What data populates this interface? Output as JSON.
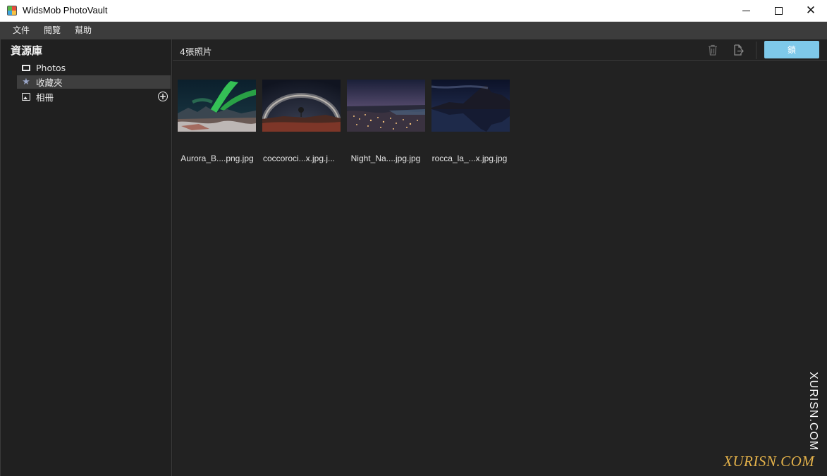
{
  "window": {
    "title": "WidsMob PhotoVault",
    "controls": {
      "minimize": "minimize",
      "maximize": "maximize",
      "close": "✕"
    }
  },
  "menu": [
    "文件",
    "閱覽",
    "幫助"
  ],
  "sidebar": {
    "title": "資源庫",
    "items": [
      {
        "label": "Photos",
        "icon": "photos-icon"
      },
      {
        "label": "收藏夾",
        "icon": "star-icon",
        "active": true
      },
      {
        "label": "相冊",
        "icon": "album-icon"
      }
    ]
  },
  "main": {
    "count_label": "4張照片",
    "toolbar": {
      "delete_icon": "trash-icon",
      "export_icon": "export-icon",
      "lock_button": "鎖"
    },
    "photos": [
      {
        "name": "Aurora_B....png.jpg"
      },
      {
        "name": "coccoroci...x.jpg.j..."
      },
      {
        "name": "Night_Na....jpg.jpg"
      },
      {
        "name": "rocca_la_...x.jpg.jpg"
      }
    ]
  },
  "watermark": {
    "vertical": "XURISN.COM",
    "logo": "XURISN.COM"
  },
  "colors": {
    "accent": "#7ec9ea",
    "background": "#202020",
    "menubar": "#3c3c3c",
    "selected": "#3e3e3e",
    "watermark_gold": "#e4b24a"
  }
}
